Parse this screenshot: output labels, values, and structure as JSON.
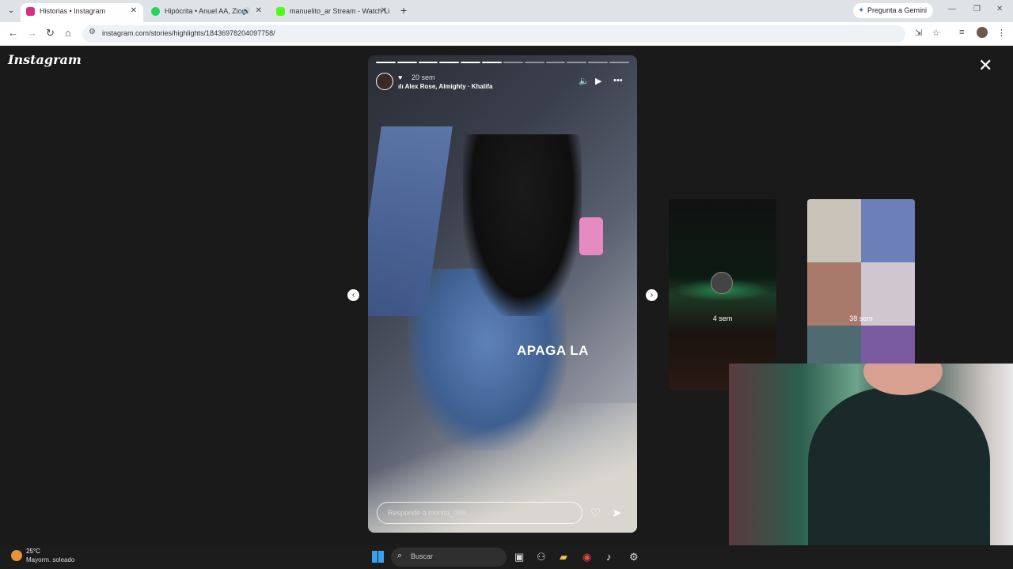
{
  "browser": {
    "tabs": [
      {
        "title": "Historias • Instagram",
        "active": true
      },
      {
        "title": "Hipócrita • Anuel AA, Zion",
        "active": false
      },
      {
        "title": "manuelito_ar Stream - Watch Li",
        "active": false
      }
    ],
    "gemini_button": "Pregunta a Gemini",
    "url": "instagram.com/stories/highlights/18436978204097758/"
  },
  "instagram": {
    "logo": "Instagram",
    "story": {
      "time": "20 sem",
      "music": "Alex Rose, Almighty · Khalifa",
      "overlay_text": "APAGA LA",
      "reply_placeholder": "Responde a monita_099..."
    },
    "previews": [
      {
        "time": "4 sem"
      },
      {
        "time": "38 sem"
      }
    ]
  },
  "taskbar": {
    "weather_temp": "25°C",
    "weather_desc": "Mayorm. soleado",
    "search_placeholder": "Buscar"
  },
  "colors": {
    "page_bg": "#1a1a1a",
    "chrome_bg": "#dfe3e8",
    "spotify": "#1ed760",
    "kick": "#53fc18",
    "instagram": "#d6307a"
  }
}
